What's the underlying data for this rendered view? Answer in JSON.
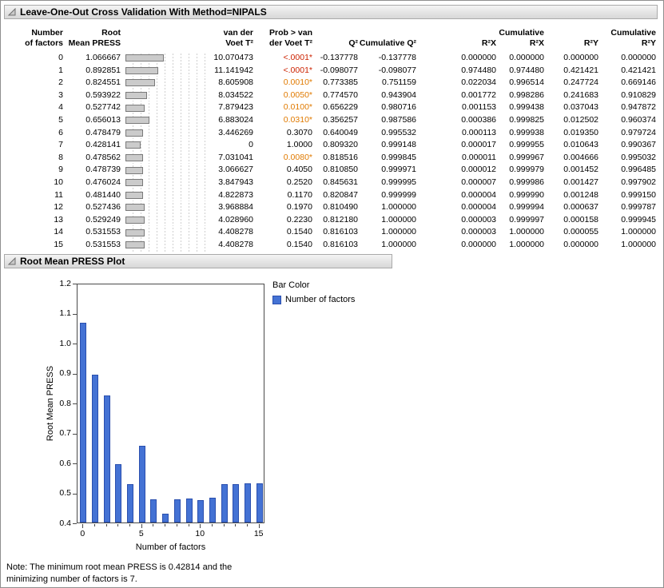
{
  "window": {
    "section1_title": "Leave-One-Out Cross Validation With Method=NIPALS",
    "section2_title": "Root Mean PRESS Plot",
    "note": "Note: The minimum root mean PRESS is 0.42814 and the minimizing number of factors is 7."
  },
  "colors": {
    "sig_high": "#cc2200",
    "sig": "#e07a00",
    "inline_bar_fill": "#cbcbcb",
    "inline_bar_border": "#7a7a7a"
  },
  "table": {
    "header": {
      "factors": [
        "Number",
        "of factors"
      ],
      "press": [
        "Root",
        "Mean PRESS"
      ],
      "voet": [
        "van der",
        "Voet T²"
      ],
      "prob": [
        "Prob > van",
        "der Voet T²"
      ],
      "q2": [
        "",
        "Q²"
      ],
      "cumq2": [
        "",
        "Cumulative Q²"
      ],
      "r2x": [
        "",
        "R²X"
      ],
      "cumr2x": [
        "Cumulative",
        "R²X"
      ],
      "r2y": [
        "",
        "R²Y"
      ],
      "cumr2y": [
        "Cumulative",
        "R²Y"
      ]
    },
    "inline_bar_axis_max": 2.2,
    "rows": [
      {
        "factors": "0",
        "press": "1.066667",
        "voet": "10.070473",
        "prob": "<.0001*",
        "prob_class": "sig-high",
        "q2": "-0.137778",
        "cumq2": "-0.137778",
        "r2x": "0.000000",
        "cumr2x": "0.000000",
        "r2y": "0.000000",
        "cumr2y": "0.000000"
      },
      {
        "factors": "1",
        "press": "0.892851",
        "voet": "11.141942",
        "prob": "<.0001*",
        "prob_class": "sig-high",
        "q2": "-0.098077",
        "cumq2": "-0.098077",
        "r2x": "0.974480",
        "cumr2x": "0.974480",
        "r2y": "0.421421",
        "cumr2y": "0.421421"
      },
      {
        "factors": "2",
        "press": "0.824551",
        "voet": "8.605908",
        "prob": "0.0010*",
        "prob_class": "sig",
        "q2": "0.773385",
        "cumq2": "0.751159",
        "r2x": "0.022034",
        "cumr2x": "0.996514",
        "r2y": "0.247724",
        "cumr2y": "0.669146"
      },
      {
        "factors": "3",
        "press": "0.593922",
        "voet": "8.034522",
        "prob": "0.0050*",
        "prob_class": "sig",
        "q2": "0.774570",
        "cumq2": "0.943904",
        "r2x": "0.001772",
        "cumr2x": "0.998286",
        "r2y": "0.241683",
        "cumr2y": "0.910829"
      },
      {
        "factors": "4",
        "press": "0.527742",
        "voet": "7.879423",
        "prob": "0.0100*",
        "prob_class": "sig",
        "q2": "0.656229",
        "cumq2": "0.980716",
        "r2x": "0.001153",
        "cumr2x": "0.999438",
        "r2y": "0.037043",
        "cumr2y": "0.947872"
      },
      {
        "factors": "5",
        "press": "0.656013",
        "voet": "6.883024",
        "prob": "0.0310*",
        "prob_class": "sig",
        "q2": "0.356257",
        "cumq2": "0.987586",
        "r2x": "0.000386",
        "cumr2x": "0.999825",
        "r2y": "0.012502",
        "cumr2y": "0.960374"
      },
      {
        "factors": "6",
        "press": "0.478479",
        "voet": "3.446269",
        "prob": "0.3070",
        "prob_class": "",
        "q2": "0.640049",
        "cumq2": "0.995532",
        "r2x": "0.000113",
        "cumr2x": "0.999938",
        "r2y": "0.019350",
        "cumr2y": "0.979724"
      },
      {
        "factors": "7",
        "press": "0.428141",
        "voet": "0",
        "prob": "1.0000",
        "prob_class": "",
        "q2": "0.809320",
        "cumq2": "0.999148",
        "r2x": "0.000017",
        "cumr2x": "0.999955",
        "r2y": "0.010643",
        "cumr2y": "0.990367"
      },
      {
        "factors": "8",
        "press": "0.478562",
        "voet": "7.031041",
        "prob": "0.0080*",
        "prob_class": "sig",
        "q2": "0.818516",
        "cumq2": "0.999845",
        "r2x": "0.000011",
        "cumr2x": "0.999967",
        "r2y": "0.004666",
        "cumr2y": "0.995032"
      },
      {
        "factors": "9",
        "press": "0.478739",
        "voet": "3.066627",
        "prob": "0.4050",
        "prob_class": "",
        "q2": "0.810850",
        "cumq2": "0.999971",
        "r2x": "0.000012",
        "cumr2x": "0.999979",
        "r2y": "0.001452",
        "cumr2y": "0.996485"
      },
      {
        "factors": "10",
        "press": "0.476024",
        "voet": "3.847943",
        "prob": "0.2520",
        "prob_class": "",
        "q2": "0.845631",
        "cumq2": "0.999995",
        "r2x": "0.000007",
        "cumr2x": "0.999986",
        "r2y": "0.001427",
        "cumr2y": "0.997902"
      },
      {
        "factors": "11",
        "press": "0.481440",
        "voet": "4.822873",
        "prob": "0.1170",
        "prob_class": "",
        "q2": "0.820847",
        "cumq2": "0.999999",
        "r2x": "0.000004",
        "cumr2x": "0.999990",
        "r2y": "0.001248",
        "cumr2y": "0.999150"
      },
      {
        "factors": "12",
        "press": "0.527436",
        "voet": "3.968884",
        "prob": "0.1970",
        "prob_class": "",
        "q2": "0.810490",
        "cumq2": "1.000000",
        "r2x": "0.000004",
        "cumr2x": "0.999994",
        "r2y": "0.000637",
        "cumr2y": "0.999787"
      },
      {
        "factors": "13",
        "press": "0.529249",
        "voet": "4.028960",
        "prob": "0.2230",
        "prob_class": "",
        "q2": "0.812180",
        "cumq2": "1.000000",
        "r2x": "0.000003",
        "cumr2x": "0.999997",
        "r2y": "0.000158",
        "cumr2y": "0.999945"
      },
      {
        "factors": "14",
        "press": "0.531553",
        "voet": "4.408278",
        "prob": "0.1540",
        "prob_class": "",
        "q2": "0.816103",
        "cumq2": "1.000000",
        "r2x": "0.000003",
        "cumr2x": "1.000000",
        "r2y": "0.000055",
        "cumr2y": "1.000000"
      },
      {
        "factors": "15",
        "press": "0.531553",
        "voet": "4.408278",
        "prob": "0.1540",
        "prob_class": "",
        "q2": "0.816103",
        "cumq2": "1.000000",
        "r2x": "0.000000",
        "cumr2x": "1.000000",
        "r2y": "0.000000",
        "cumr2y": "1.000000"
      }
    ]
  },
  "chart_data": {
    "type": "bar",
    "title": "Root Mean PRESS Plot",
    "xlabel": "Number of factors",
    "ylabel": "Root Mean PRESS",
    "categories": [
      0,
      1,
      2,
      3,
      4,
      5,
      6,
      7,
      8,
      9,
      10,
      11,
      12,
      13,
      14,
      15
    ],
    "values": [
      1.066667,
      0.892851,
      0.824551,
      0.593922,
      0.527742,
      0.656013,
      0.478479,
      0.428141,
      0.478562,
      0.478739,
      0.476024,
      0.48144,
      0.527436,
      0.529249,
      0.531553,
      0.531553
    ],
    "ylim": [
      0.4,
      1.2
    ],
    "ytick_step": 0.1,
    "xticks": [
      0,
      5,
      10,
      15
    ],
    "grid": false,
    "bar_color": "#4472d4",
    "legend": {
      "position": "right",
      "title": "Bar Color",
      "entries": [
        {
          "label": "Number of factors",
          "color": "#4472d4"
        }
      ]
    }
  }
}
